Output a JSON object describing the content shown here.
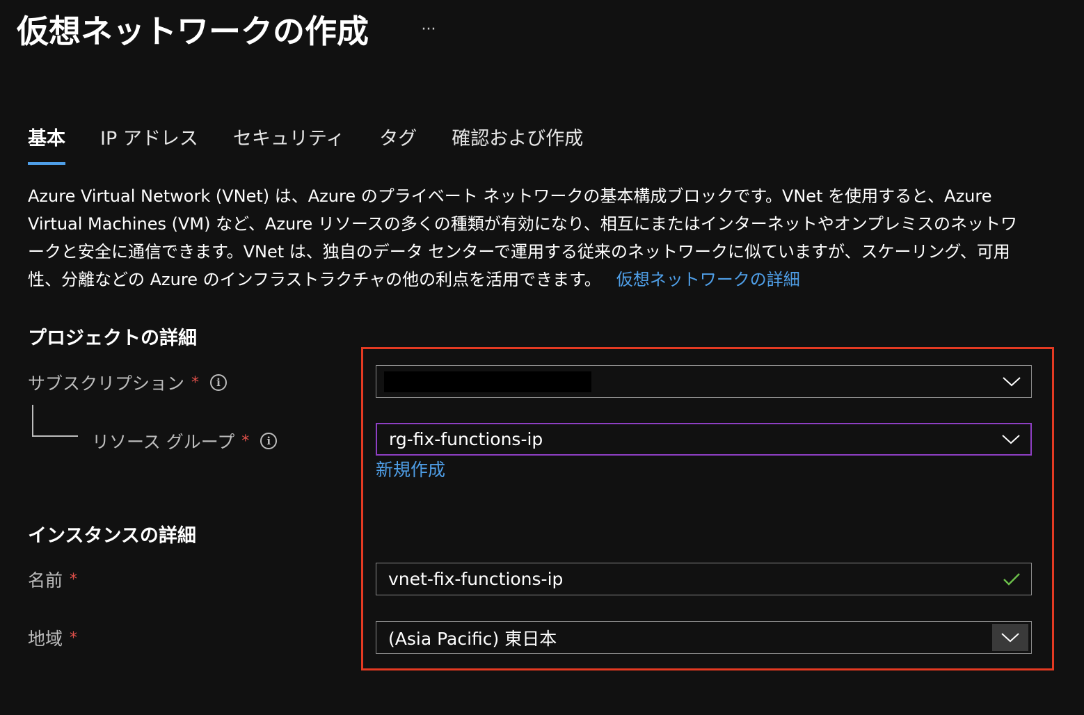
{
  "page": {
    "title": "仮想ネットワークの作成",
    "more_label": "···"
  },
  "tabs": [
    {
      "label": "基本",
      "active": true
    },
    {
      "label": "IP アドレス",
      "active": false
    },
    {
      "label": "セキュリティ",
      "active": false
    },
    {
      "label": "タグ",
      "active": false
    },
    {
      "label": "確認および作成",
      "active": false
    }
  ],
  "description": {
    "text": "Azure Virtual Network (VNet) は、Azure のプライベート ネットワークの基本構成ブロックです。VNet を使用すると、Azure Virtual Machines (VM) など、Azure リソースの多くの種類が有効になり、相互にまたはインターネットやオンプレミスのネットワークと安全に通信できます。VNet は、独自のデータ センターで運用する従来のネットワークに似ていますが、スケーリング、可用性、分離などの Azure のインフラストラクチャの他の利点を活用できます。",
    "link_label": "仮想ネットワークの詳細"
  },
  "project_details": {
    "heading": "プロジェクトの詳細",
    "subscription": {
      "label": "サブスクリプション",
      "required_mark": "*",
      "info_glyph": "i"
    },
    "resource_group": {
      "label": "リソース グループ",
      "required_mark": "*",
      "info_glyph": "i",
      "value": "rg-fix-functions-ip",
      "create_new_label": "新規作成"
    }
  },
  "instance_details": {
    "heading": "インスタンスの詳細",
    "name": {
      "label": "名前",
      "required_mark": "*",
      "value": "vnet-fix-functions-ip"
    },
    "region": {
      "label": "地域",
      "required_mark": "*",
      "value": "(Asia Pacific) 東日本"
    }
  },
  "colors": {
    "background": "#111111",
    "accent_link": "#4f9fe8",
    "required": "#e2514b",
    "focus_border": "#8e3fc4",
    "highlight_frame": "#e43a22",
    "valid_check": "#6cc04a"
  },
  "icons": {
    "chevron": "chevron-down-icon",
    "check": "checkmark-icon",
    "info": "info-icon"
  }
}
